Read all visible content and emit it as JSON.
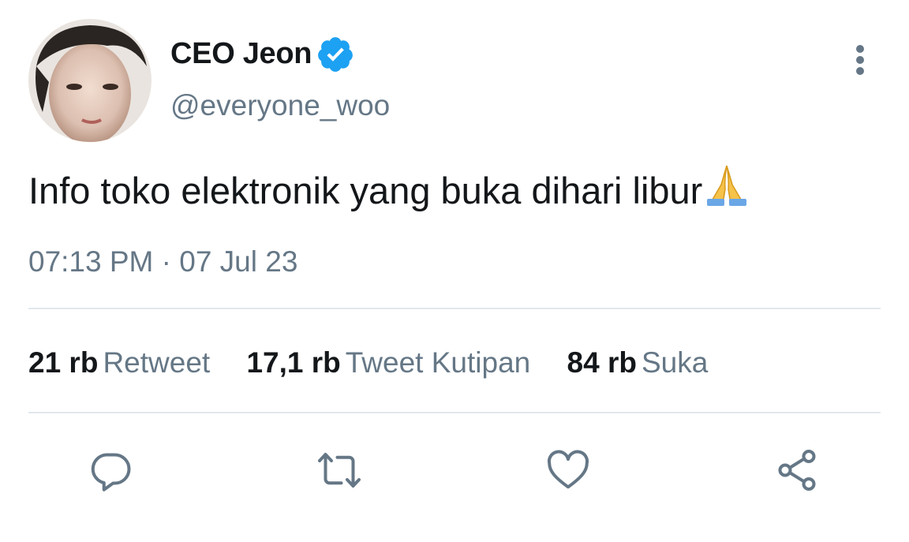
{
  "tweet": {
    "author": {
      "display_name": "CEO Jeon",
      "handle": "@everyone_woo",
      "verified": true,
      "verified_icon": "verified-badge-icon"
    },
    "text": "Info toko elektronik yang buka dihari libur",
    "emoji": "🙏",
    "timestamp": "07:13 PM · 07 Jul 23",
    "stats": [
      {
        "count": "21 rb",
        "label": "Retweet"
      },
      {
        "count": "17,1 rb",
        "label": "Tweet Kutipan"
      },
      {
        "count": "84 rb",
        "label": "Suka"
      }
    ]
  },
  "actions": {
    "icons": [
      "reply-icon",
      "retweet-icon",
      "like-icon",
      "share-icon"
    ]
  },
  "colors": {
    "primary_text": "#14171a",
    "secondary_text": "#657786",
    "verified_blue": "#1da1f2",
    "divider": "#e1e8ed"
  }
}
